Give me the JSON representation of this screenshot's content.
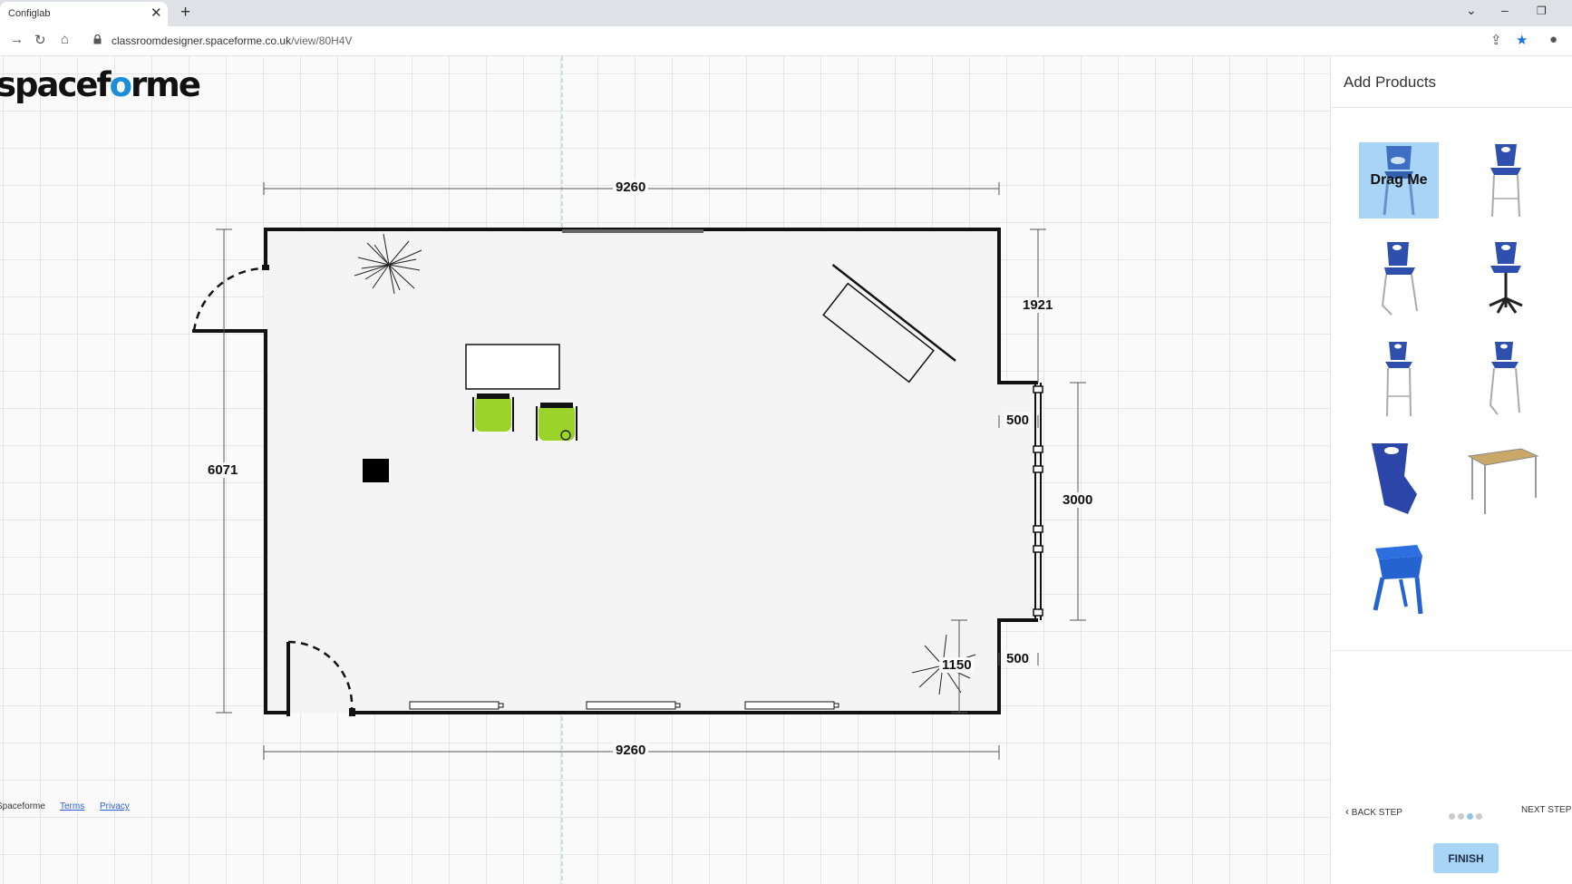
{
  "browser": {
    "tab_title": "Configlab",
    "url_domain": "classroomdesigner.spaceforme.co.uk",
    "url_path": "/view/80H4V"
  },
  "brand": {
    "logo_pre": "spacef",
    "logo_o": "o",
    "logo_post": "rme"
  },
  "plan": {
    "dimensions": {
      "top": "9260",
      "bottom": "9260",
      "left": "6071",
      "right_upper": "1921",
      "right_window": "3000",
      "recess_top": "500",
      "recess_bottom": "500",
      "corner": "1150"
    }
  },
  "footer": {
    "company": "Spaceforme",
    "terms": "Terms",
    "privacy": "Privacy"
  },
  "panel": {
    "title": "Add Products",
    "drag_label": "Drag Me",
    "products": [
      "blue-chair-icon",
      "blue-stool-chair-icon",
      "blue-skid-chair-icon",
      "blue-swivel-chair-icon",
      "blue-high-stool-icon",
      "blue-high-skid-stool-icon",
      "blue-rocker-chair-icon",
      "oak-table-icon",
      "blue-stool-icon"
    ],
    "back_step": "BACK STEP",
    "next_step": "NEXT STEP",
    "steps_total": 4,
    "steps_current": 3,
    "finish": "FINISH"
  },
  "colors": {
    "accent": "#a8d5f5",
    "chair_green": "#9bd32a",
    "brand_blue": "#1a8fd8"
  }
}
